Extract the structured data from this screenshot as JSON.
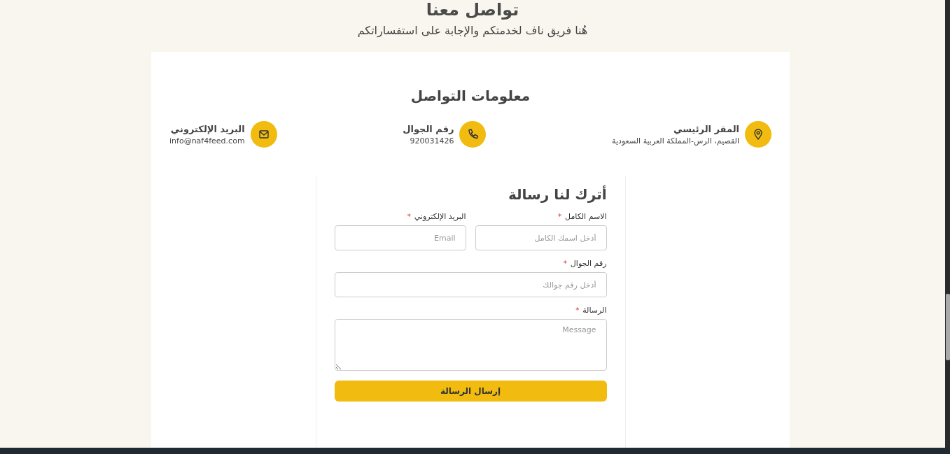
{
  "page": {
    "title": "تواصل معنا",
    "subtitle": "هُنا فريق ناف لخدمتكم والإجابة على استفساراتكم"
  },
  "contact": {
    "title": "معلومات التواصل",
    "items": [
      {
        "kind": "location",
        "label": "المقر الرئيسي",
        "value": "القصيم، الرس-المملكة العربية السعودية"
      },
      {
        "kind": "phone",
        "label": "رقم الجوال",
        "value": "920031426"
      },
      {
        "kind": "email",
        "label": "البريد الإلكتروني",
        "value": "info@naf4feed.com"
      }
    ]
  },
  "form": {
    "title": "أترك لنا رسالة",
    "fields": [
      {
        "kind": "text",
        "label": "الاسم الكامل",
        "mark": "*",
        "placeholder": "أدخل اسمك الكامل"
      },
      {
        "kind": "email",
        "label": "البريد الإلكتروني",
        "mark": "*",
        "placeholder": "Email"
      },
      {
        "kind": "tel",
        "label": "رقم الجوال",
        "mark": "*",
        "placeholder": "أدخل رقم جوالك"
      },
      {
        "kind": "textarea",
        "label": "الرسالة",
        "mark": "*",
        "placeholder": "Message"
      }
    ],
    "submit": "إرسال الرسالة"
  }
}
